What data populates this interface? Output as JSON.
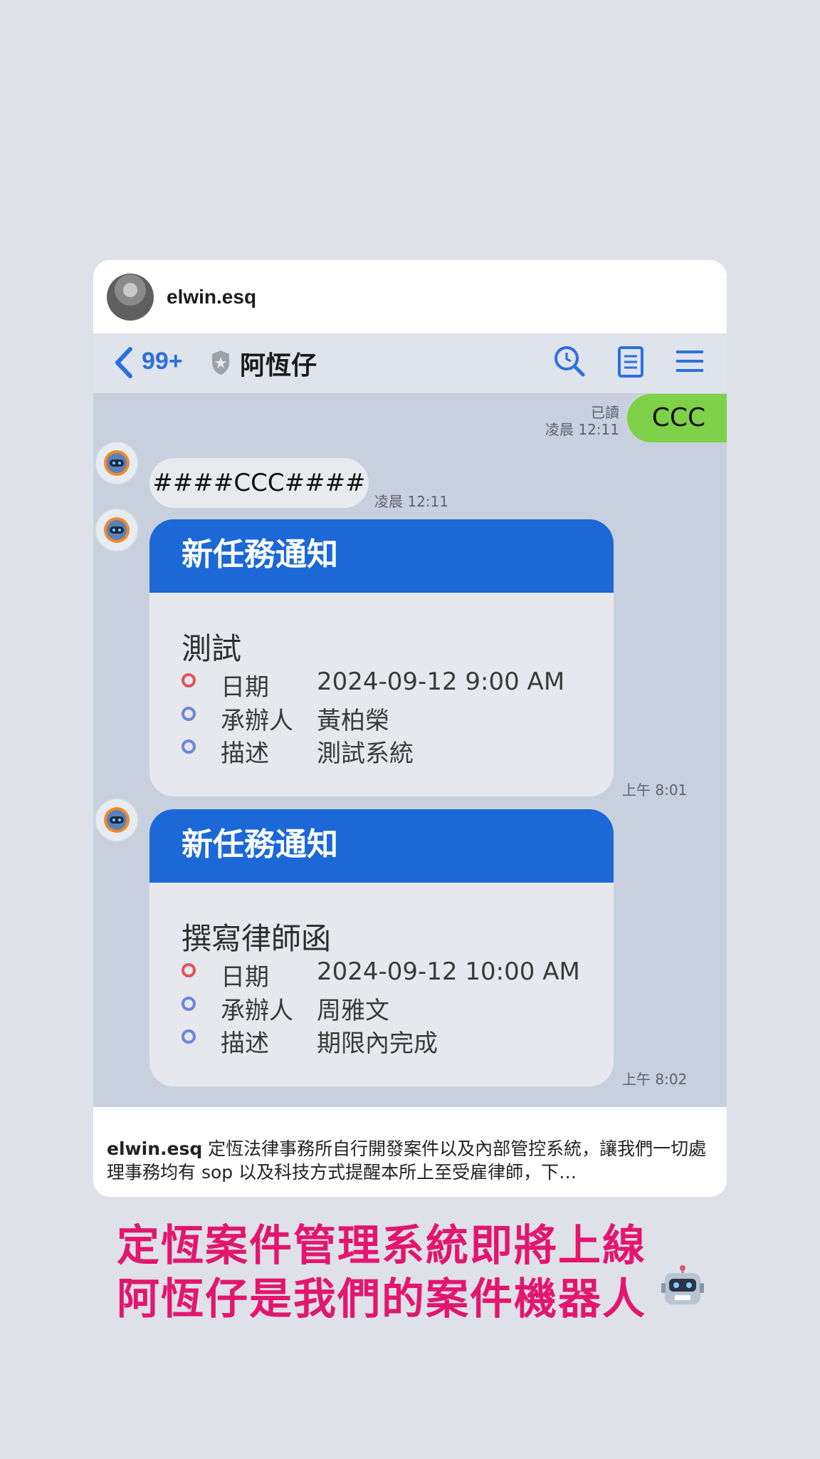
{
  "post": {
    "username": "elwin.esq"
  },
  "chat_header": {
    "unread_count": "99+",
    "chat_name": "阿恆仔",
    "icons": [
      "back-chevron-icon",
      "shield-icon",
      "search-icon",
      "notes-icon",
      "menu-icon"
    ],
    "accent_color": "#2c6fe0"
  },
  "messages": {
    "sent": {
      "text": "CCC",
      "read_label": "已讀",
      "time": "凌晨 12:11",
      "color": "#7ed148"
    },
    "received": {
      "text": "####CCC####",
      "time": "凌晨 12:11"
    }
  },
  "tasks": [
    {
      "header": "新任務通知",
      "title": "測試",
      "rows": [
        {
          "label": "日期",
          "value": "2024-09-12 9:00 AM"
        },
        {
          "label": "承辦人",
          "value": "黃柏榮"
        },
        {
          "label": "描述",
          "value": "測試系統"
        }
      ],
      "time": "上午 8:01"
    },
    {
      "header": "新任務通知",
      "title": "撰寫律師函",
      "rows": [
        {
          "label": "日期",
          "value": "2024-09-12 10:00 AM"
        },
        {
          "label": "承辦人",
          "value": "周雅文"
        },
        {
          "label": "描述",
          "value": "期限內完成"
        }
      ],
      "time": "上午 8:02"
    }
  ],
  "caption": {
    "username": "elwin.esq",
    "text": " 定恆法律事務所自行開發案件以及內部管控系統，讓我們一切處理事務均有 sop 以及科技方式提醒本所上至受雇律師，下…"
  },
  "promo": {
    "line1": "定恆案件管理系統即將上線",
    "line2": "阿恆仔是我們的案件機器人",
    "emoji_icon": "robot-face-icon",
    "color": "#e3166e"
  },
  "colors": {
    "task_header": "#1b68d6",
    "chat_bg": "#c9d0dd",
    "page_bg": "#dfe1e8"
  }
}
